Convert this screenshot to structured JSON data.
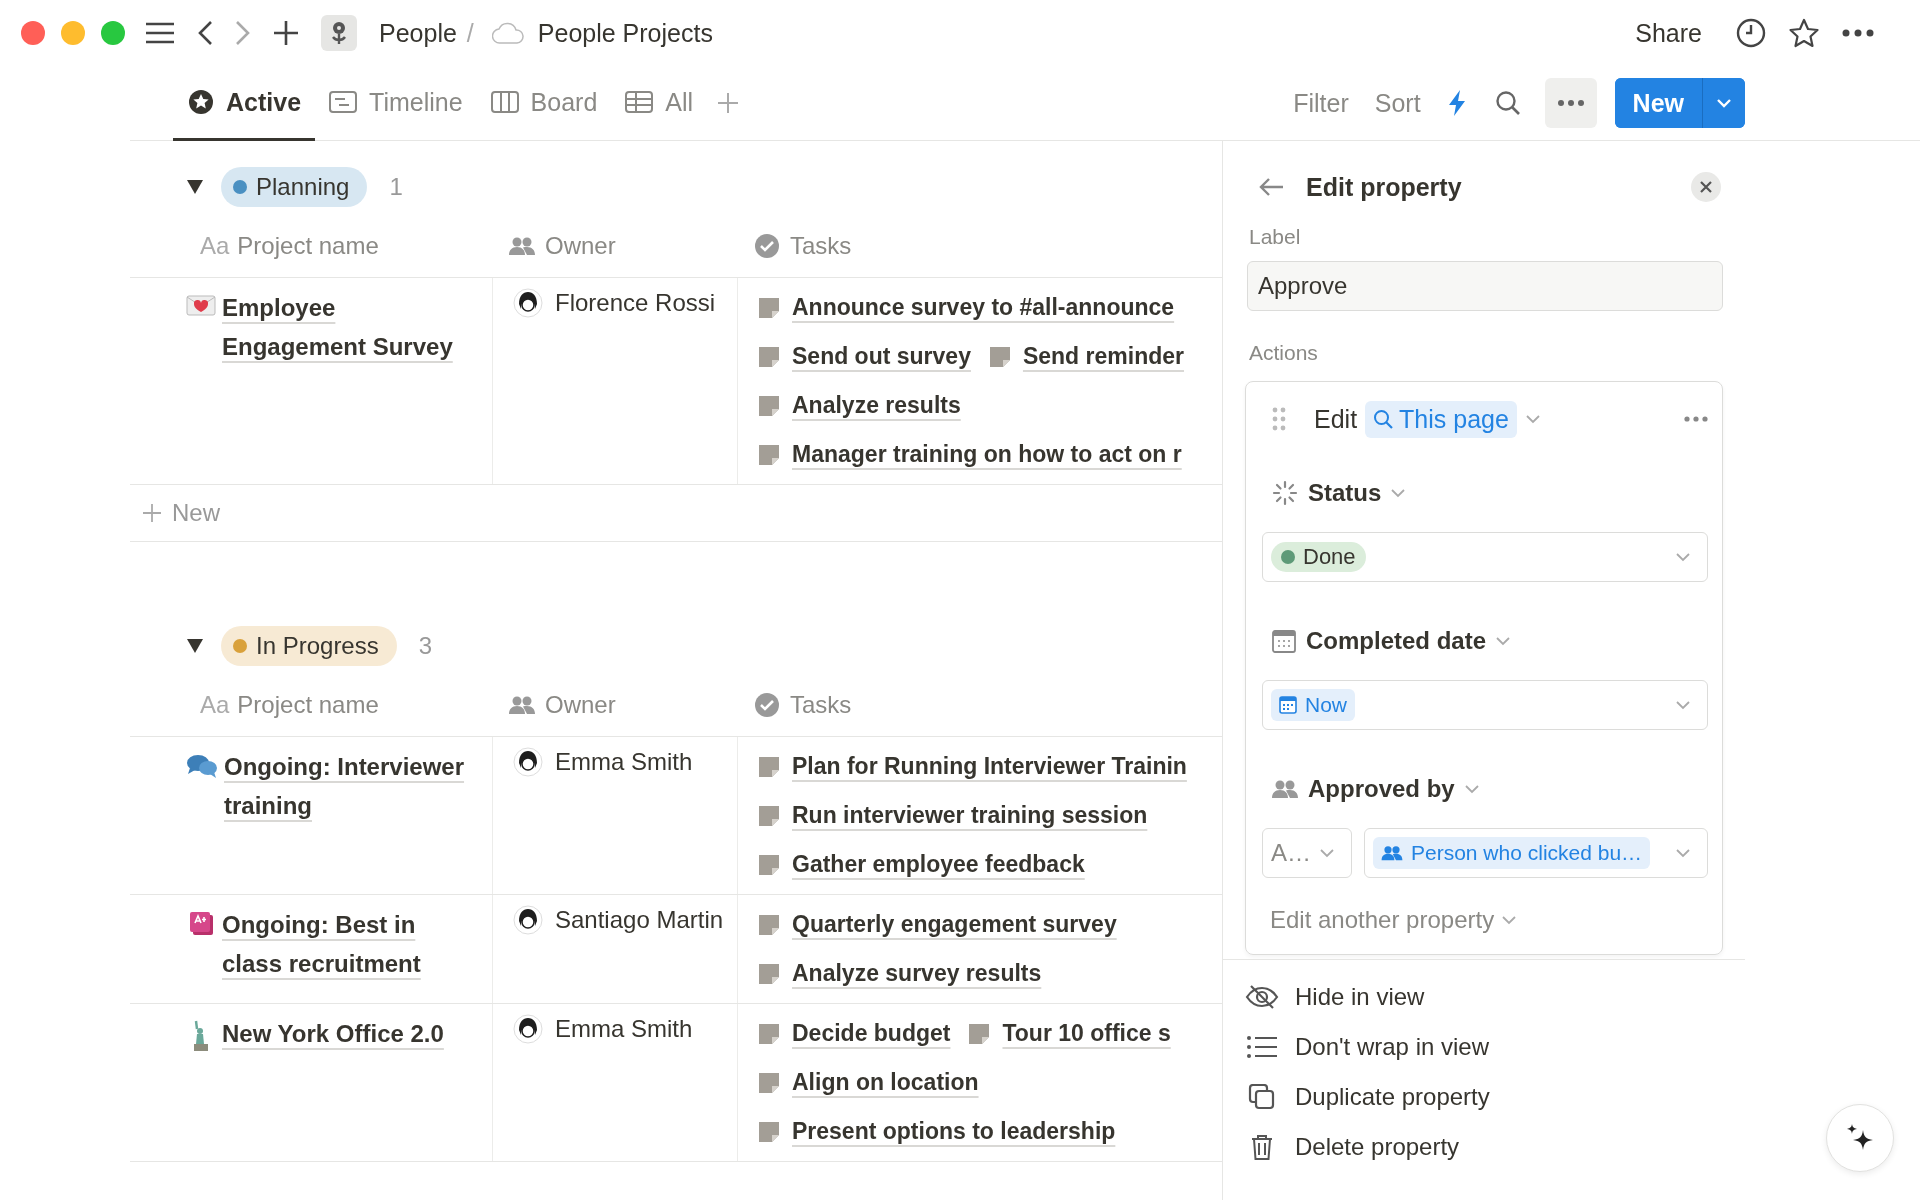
{
  "breadcrumb": {
    "parent": "People",
    "separator": "/",
    "page": "People Projects"
  },
  "top_actions": {
    "share": "Share"
  },
  "tabs": [
    {
      "kind": "star",
      "label": "Active",
      "selected": true
    },
    {
      "kind": "timeline",
      "label": "Timeline",
      "selected": false
    },
    {
      "kind": "board",
      "label": "Board",
      "selected": false
    },
    {
      "kind": "table",
      "label": "All",
      "selected": false
    }
  ],
  "toolbar": {
    "filter": "Filter",
    "sort": "Sort",
    "new_button": "New"
  },
  "groups": [
    {
      "name": "Planning",
      "color": "#4a90c2",
      "count": "1",
      "columns": [
        {
          "kind": "text",
          "prefix": "Aa",
          "label": "Project name"
        },
        {
          "kind": "person",
          "label": "Owner"
        },
        {
          "kind": "check",
          "label": "Tasks"
        }
      ],
      "rows": [
        {
          "kind": "envelope",
          "name": "Employee Engagement Survey",
          "owner": "Florence Rossi",
          "tasks": [
            [
              "Announce survey to #all-announce"
            ],
            [
              "Send out survey",
              "Send reminder"
            ],
            [
              "Analyze results"
            ],
            [
              "Manager training on how to act on r"
            ]
          ]
        }
      ],
      "new_label": "New"
    },
    {
      "name": "In Progress",
      "color": "#d9a13b",
      "count": "3",
      "columns": [
        {
          "kind": "text",
          "prefix": "Aa",
          "label": "Project name"
        },
        {
          "kind": "person",
          "label": "Owner"
        },
        {
          "kind": "check",
          "label": "Tasks"
        }
      ],
      "rows": [
        {
          "kind": "chat",
          "name": "Ongoing: Interviewer training",
          "owner": "Emma Smith",
          "tasks": [
            [
              "Plan for Running Interviewer Trainin"
            ],
            [
              "Run interviewer training session"
            ],
            [
              "Gather employee feedback"
            ]
          ]
        },
        {
          "kind": "grade",
          "name": "Ongoing: Best in class recruitment",
          "owner": "Santiago Martin",
          "tasks": [
            [
              "Quarterly engagement survey"
            ],
            [
              "Analyze survey results"
            ]
          ]
        },
        {
          "kind": "statue",
          "name": "New York Office 2.0",
          "owner": "Emma Smith",
          "tasks": [
            [
              "Decide budget",
              "Tour 10 office s"
            ],
            [
              "Align on location"
            ],
            [
              "Present options to leadership"
            ]
          ]
        }
      ]
    }
  ],
  "panel": {
    "title": "Edit property",
    "label_heading": "Label",
    "label_value": "Approve",
    "actions_heading": "Actions",
    "action": {
      "verb": "Edit",
      "target": "This page",
      "properties": [
        {
          "kind": "status",
          "name": "Status",
          "value": "Done",
          "color": "#5e9a78"
        },
        {
          "kind": "date",
          "name": "Completed date",
          "value": "Now"
        },
        {
          "kind": "person",
          "name": "Approved by",
          "operator": "A…",
          "value": "Person who clicked bu…"
        }
      ],
      "add_label": "Edit another property"
    },
    "menu": [
      {
        "kind": "hide",
        "label": "Hide in view"
      },
      {
        "kind": "nowrap",
        "label": "Don't wrap in view"
      },
      {
        "kind": "duplicate",
        "label": "Duplicate property"
      },
      {
        "kind": "delete",
        "label": "Delete property"
      }
    ]
  }
}
